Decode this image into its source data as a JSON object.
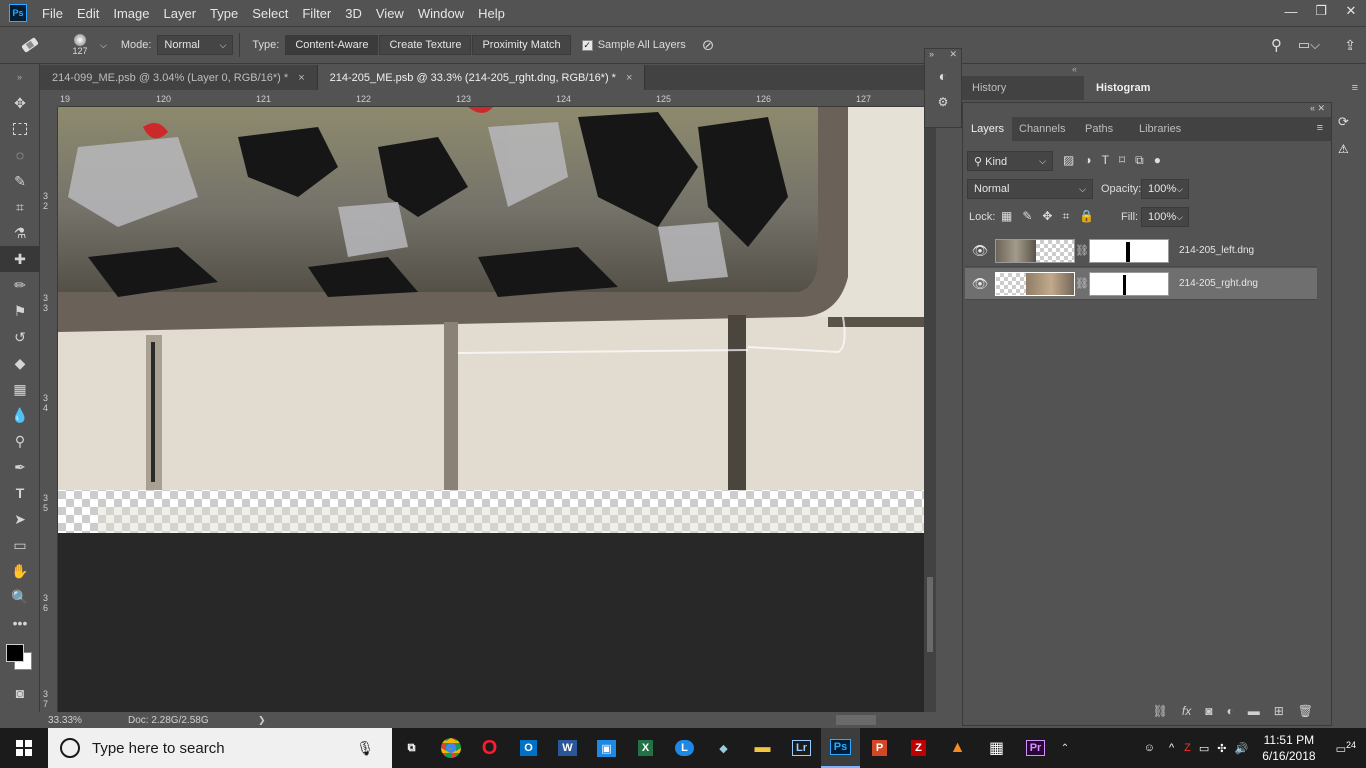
{
  "menu": {
    "logo": "Ps",
    "items": [
      "File",
      "Edit",
      "Image",
      "Layer",
      "Type",
      "Select",
      "Filter",
      "3D",
      "View",
      "Window",
      "Help"
    ]
  },
  "window_controls": {
    "minimize": "—",
    "restore": "❐",
    "close": "✕"
  },
  "options": {
    "brush_size": "127",
    "mode_label": "Mode:",
    "mode_value": "Normal",
    "type_label": "Type:",
    "type_buttons": [
      "Content-Aware",
      "Create Texture",
      "Proximity Match"
    ],
    "sample_all_layers": "Sample All Layers"
  },
  "tabs": [
    {
      "label": "214-099_ME.psb @ 3.04% (Layer 0, RGB/16*) *",
      "close": "×"
    },
    {
      "label": "214-205_ME.psb @ 33.3% (214-205_rght.dng, RGB/16*) *",
      "close": "×"
    }
  ],
  "ruler": {
    "top": [
      "19",
      "120",
      "121",
      "122",
      "123",
      "124",
      "125",
      "126",
      "127"
    ],
    "left": [
      "3 2",
      "3 3",
      "3 4",
      "3 5",
      "3 6",
      "3 7"
    ]
  },
  "status": {
    "zoom": "33.33%",
    "doc": "Doc: 2.28G/2.58G",
    "arrow": "❯"
  },
  "panels": {
    "history_tab": "History",
    "histogram_tab": "Histogram",
    "layers_tabs": [
      "Layers",
      "Channels",
      "Paths",
      "Libraries"
    ],
    "kind_label": "Kind",
    "blend_mode": "Normal",
    "opacity_label": "Opacity:",
    "opacity_value": "100%",
    "lock_label": "Lock:",
    "fill_label": "Fill:",
    "fill_value": "100%",
    "layers": [
      {
        "name": "214-205_left.dng"
      },
      {
        "name": "214-205_rght.dng"
      }
    ]
  },
  "taskbar": {
    "search_placeholder": "Type here to search",
    "apps": [
      "Chrome",
      "Opera",
      "Outlook",
      "Word",
      "App",
      "Excel",
      "Lync",
      "Photos",
      "Explorer",
      "Lr",
      "Ps",
      "PowerPoint",
      "FileZilla",
      "Avast",
      "Calculator",
      "Pr"
    ],
    "time": "11:51 PM",
    "date": "6/16/2018",
    "notifications": "24"
  },
  "colors": {
    "accent": "#31a8ff",
    "panel": "#535353",
    "dark": "#424242",
    "taskbar": "#1b1b1b"
  }
}
